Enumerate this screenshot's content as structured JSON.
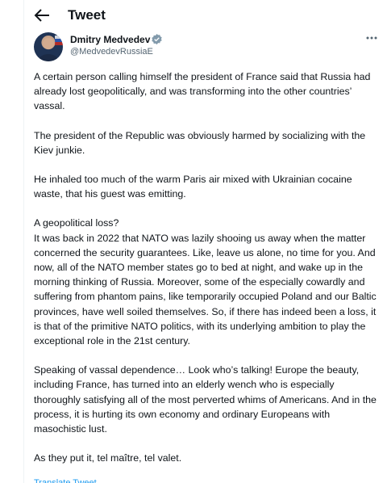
{
  "header": {
    "title": "Tweet",
    "back_icon": "arrow-left-icon"
  },
  "author": {
    "name": "Dmitry Medvedev",
    "handle": "@MedvedevRussiaE",
    "verified_icon": "verified-badge-icon",
    "verified_color": "#829aab"
  },
  "tweet": {
    "paragraphs": [
      "A certain person calling himself the president of France said that Russia had already lost geopolitically, and was transforming into the other countries’ vassal.",
      "The president of the Republic was obviously harmed by socializing with the Kiev junkie.",
      "He inhaled too much of the warm Paris air mixed with Ukrainian cocaine waste, that his guest was emitting.",
      "A geopolitical loss?\nIt was back in 2022 that NATO was lazily shooing us away when the matter concerned the security guarantees. Like, leave us alone, no time for you. And now, all of the NATO member states go to bed at night, and wake up in the morning thinking of Russia. Moreover, some of the especially cowardly and suffering from phantom pains, like temporarily occupied Poland and our Baltic provinces, have well soiled themselves. So, if there has indeed been a loss, it is that of the primitive NATO politics, with its underlying ambition to play the exceptional role in the 21st century.",
      "Speaking of vassal dependence… Look who’s talking! Europe the beauty, including France, has turned into an elderly wench who is especially thoroughly satisfying all of the most perverted whims of Americans. And in the process, it is hurting its own economy and ordinary Europeans with masochistic lust.",
      "As they put it, tel maître, tel valet."
    ],
    "translate_link": "Translate Tweet"
  },
  "colors": {
    "text": "#0f1419",
    "secondary": "#536471",
    "accent": "#1d9bf0"
  }
}
